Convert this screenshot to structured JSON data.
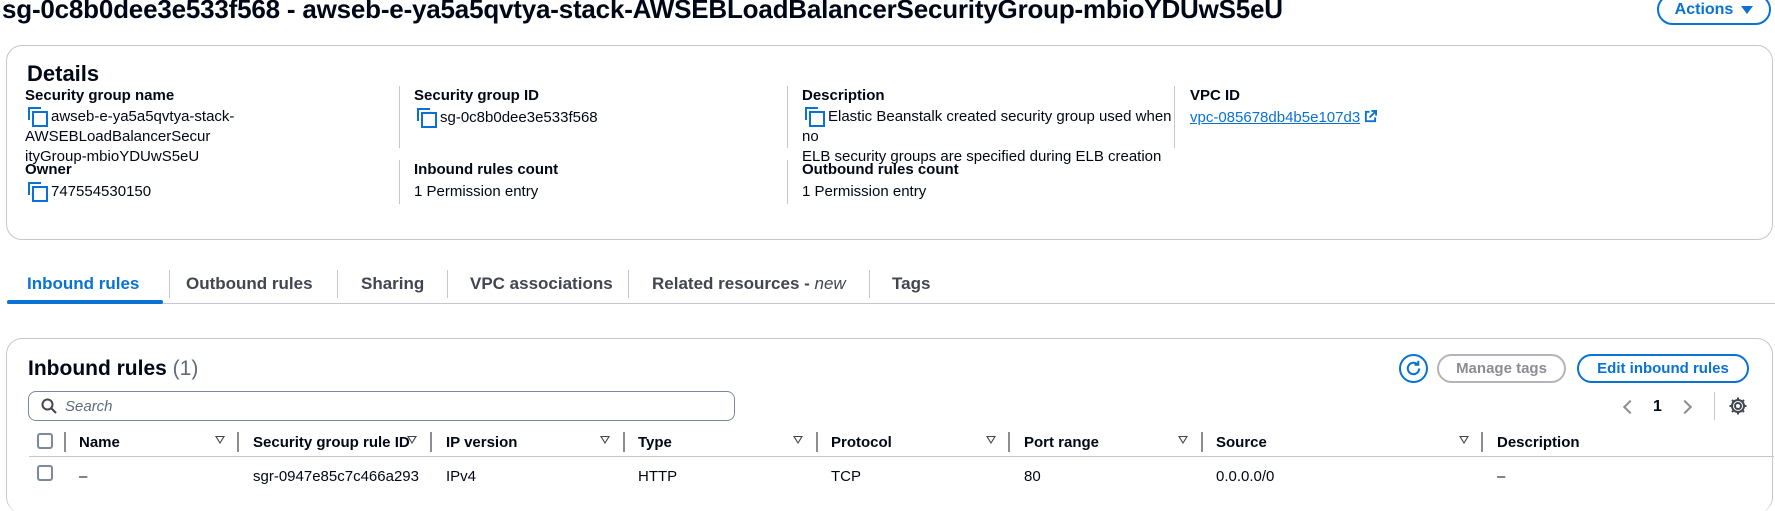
{
  "page": {
    "title": "sg-0c8b0dee3e533f568 - awseb-e-ya5a5qvtya-stack-AWSEBLoadBalancerSecurityGroup-mbioYDUwS5eU",
    "actions_label": "Actions"
  },
  "details": {
    "title": "Details",
    "sg_name_label": "Security group name",
    "sg_name_line1": "awseb-e-ya5a5qvtya-stack-AWSEBLoadBalancerSecur",
    "sg_name_line2": "ityGroup-mbioYDUwS5eU",
    "sg_id_label": "Security group ID",
    "sg_id": "sg-0c8b0dee3e533f568",
    "description_label": "Description",
    "description_line1": "Elastic Beanstalk created security group used when no",
    "description_line2": "ELB security groups are specified during ELB creation",
    "vpc_label": "VPC ID",
    "vpc_id": "vpc-085678db4b5e107d3",
    "owner_label": "Owner",
    "owner": "747554530150",
    "inbound_count_label": "Inbound rules count",
    "inbound_count": "1 Permission entry",
    "outbound_count_label": "Outbound rules count",
    "outbound_count": "1 Permission entry"
  },
  "tabs": [
    {
      "label": "Inbound rules",
      "active": true
    },
    {
      "label": "Outbound rules"
    },
    {
      "label": "Sharing"
    },
    {
      "label": "VPC associations"
    },
    {
      "label": "Related resources - ",
      "suffix": "new"
    },
    {
      "label": "Tags"
    }
  ],
  "rules": {
    "title": "Inbound rules",
    "count": "(1)",
    "manage_tags_label": "Manage tags",
    "edit_label": "Edit inbound rules",
    "search_placeholder": "Search",
    "page_number": "1",
    "columns": [
      "Name",
      "Security group rule ID",
      "IP version",
      "Type",
      "Protocol",
      "Port range",
      "Source",
      "Description"
    ],
    "rows": [
      [
        "–",
        "sgr-0947e85c7c466a293",
        "IPv4",
        "HTTP",
        "TCP",
        "80",
        "0.0.0.0/0",
        "–"
      ]
    ]
  },
  "colors": {
    "accent": "#0972d3",
    "text": "#000716",
    "border": "#c6c6cd",
    "disabled": "#8c8c94"
  }
}
